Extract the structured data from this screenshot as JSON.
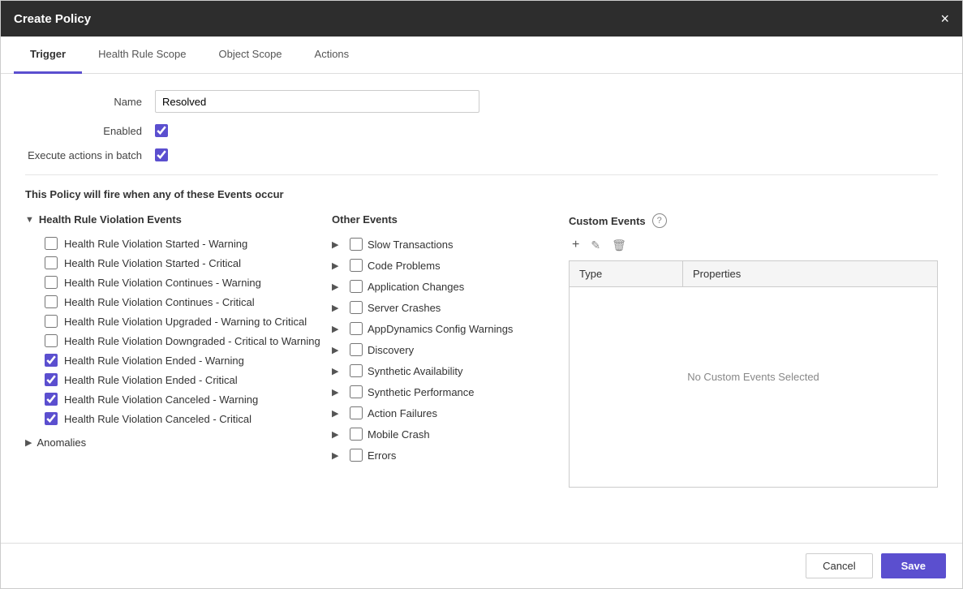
{
  "modal": {
    "title": "Create Policy",
    "close_label": "×"
  },
  "tabs": [
    {
      "id": "trigger",
      "label": "Trigger",
      "active": true
    },
    {
      "id": "health-rule-scope",
      "label": "Health Rule Scope",
      "active": false
    },
    {
      "id": "object-scope",
      "label": "Object Scope",
      "active": false
    },
    {
      "id": "actions",
      "label": "Actions",
      "active": false
    }
  ],
  "form": {
    "name_label": "Name",
    "name_value": "Resolved",
    "name_placeholder": "",
    "enabled_label": "Enabled",
    "batch_label": "Execute actions in batch"
  },
  "policy_description": "This Policy will fire when any of these Events occur",
  "health_violation_events": {
    "header": "Health Rule Violation Events",
    "items": [
      {
        "label": "Health Rule Violation Started - Warning",
        "checked": false
      },
      {
        "label": "Health Rule Violation Started - Critical",
        "checked": false
      },
      {
        "label": "Health Rule Violation Continues - Warning",
        "checked": false
      },
      {
        "label": "Health Rule Violation Continues - Critical",
        "checked": false
      },
      {
        "label": "Health Rule Violation Upgraded - Warning to Critical",
        "checked": false
      },
      {
        "label": "Health Rule Violation Downgraded - Critical to Warning",
        "checked": false
      },
      {
        "label": "Health Rule Violation Ended - Warning",
        "checked": true
      },
      {
        "label": "Health Rule Violation Ended - Critical",
        "checked": true
      },
      {
        "label": "Health Rule Violation Canceled - Warning",
        "checked": true
      },
      {
        "label": "Health Rule Violation Canceled - Critical",
        "checked": true
      }
    ]
  },
  "anomalies": {
    "header": "Anomalies"
  },
  "other_events": {
    "header": "Other Events",
    "items": [
      {
        "label": "Slow Transactions",
        "checked": false
      },
      {
        "label": "Code Problems",
        "checked": false
      },
      {
        "label": "Application Changes",
        "checked": false
      },
      {
        "label": "Server Crashes",
        "checked": false
      },
      {
        "label": "AppDynamics Config Warnings",
        "checked": false
      },
      {
        "label": "Discovery",
        "checked": false
      },
      {
        "label": "Synthetic Availability",
        "checked": false
      },
      {
        "label": "Synthetic Performance",
        "checked": false
      },
      {
        "label": "Action Failures",
        "checked": false
      },
      {
        "label": "Mobile Crash",
        "checked": false
      },
      {
        "label": "Errors",
        "checked": false
      }
    ]
  },
  "custom_events": {
    "header": "Custom Events",
    "help_icon": "?",
    "add_icon": "+",
    "edit_icon": "✎",
    "delete_icon": "🗑",
    "table": {
      "columns": [
        "Type",
        "Properties"
      ],
      "empty_message": "No Custom Events Selected"
    }
  },
  "footer": {
    "cancel_label": "Cancel",
    "save_label": "Save"
  }
}
